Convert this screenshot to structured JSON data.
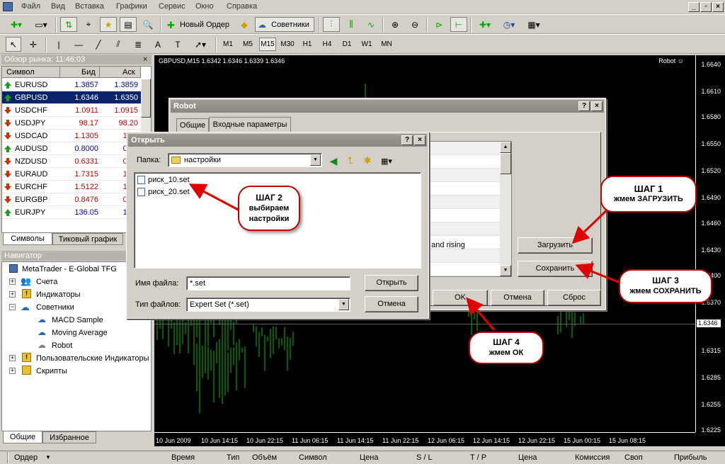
{
  "menu": [
    "Файл",
    "Вид",
    "Вставка",
    "Графики",
    "Сервис",
    "Окно",
    "Справка"
  ],
  "toolbar": {
    "new_order": "Новый Ордер",
    "experts": "Советники",
    "timeframes": [
      "M1",
      "M5",
      "M15",
      "M30",
      "H1",
      "H4",
      "D1",
      "W1",
      "MN"
    ],
    "active_timeframe": "M15"
  },
  "market_watch": {
    "title": "Обзор рынка: 11:46:03",
    "columns": [
      "Символ",
      "Бид",
      "Аск"
    ],
    "rows": [
      {
        "symbol": "EURUSD",
        "bid": "1.3857",
        "ask": "1.3859",
        "dir": "up"
      },
      {
        "symbol": "GBPUSD",
        "bid": "1.6346",
        "ask": "1.6350",
        "dir": "up"
      },
      {
        "symbol": "USDCHF",
        "bid": "1.0911",
        "ask": "1.0915",
        "dir": "down"
      },
      {
        "symbol": "USDJPY",
        "bid": "98.17",
        "ask": "98.20",
        "dir": "down"
      },
      {
        "symbol": "USDCAD",
        "bid": "1.1305",
        "ask": "1.13",
        "dir": "down"
      },
      {
        "symbol": "AUDUSD",
        "bid": "0.8000",
        "ask": "0.80",
        "dir": "up"
      },
      {
        "symbol": "NZDUSD",
        "bid": "0.6331",
        "ask": "0.63",
        "dir": "down"
      },
      {
        "symbol": "EURAUD",
        "bid": "1.7315",
        "ask": "1.73",
        "dir": "down"
      },
      {
        "symbol": "EURCHF",
        "bid": "1.5122",
        "ask": "1.51",
        "dir": "down"
      },
      {
        "symbol": "EURGBP",
        "bid": "0.8476",
        "ask": "0.84",
        "dir": "down"
      },
      {
        "symbol": "EURJPY",
        "bid": "136.05",
        "ask": "136.",
        "dir": "up"
      }
    ],
    "tabs": [
      "Символы",
      "Тиковый график"
    ]
  },
  "navigator": {
    "title": "Навигатор",
    "root": "MetaTrader - E-Global TFG",
    "items": [
      "Счета",
      "Индикаторы",
      "Советники",
      "MACD Sample",
      "Moving Average",
      "Robot",
      "Пользовательские Индикаторы",
      "Скрипты"
    ],
    "tabs": [
      "Общие",
      "Избранное"
    ]
  },
  "chart": {
    "header": "GBPUSD,M15  1.6342 1.6346 1.6339 1.6346",
    "expert": "Robot",
    "prices": [
      "1.6640",
      "1.6610",
      "1.6580",
      "1.6550",
      "1.6520",
      "1.6490",
      "1.6460",
      "1.6430",
      "1.6400",
      "1.6370",
      "1.6346",
      "1.6315",
      "1.6285",
      "1.6255",
      "1.6225"
    ],
    "dates": [
      "10 Jun 2009",
      "10 Jun 14:15",
      "10 Jun 22:15",
      "11 Jun 06:15",
      "11 Jun 14:15",
      "11 Jun 22:15",
      "12 Jun 06:15",
      "12 Jun 14:15",
      "12 Jun 22:15",
      "15 Jun 00:15",
      "15 Jun 08:15"
    ]
  },
  "robot_dialog": {
    "title": "Robot",
    "tabs": [
      "Общие",
      "Входные параметры"
    ],
    "visible_text": "e and rising",
    "load": "Загрузить",
    "save": "Сохранить",
    "ok": "OK",
    "cancel": "Отмена",
    "reset": "Сброс"
  },
  "open_dialog": {
    "title": "Открыть",
    "folder_label": "Папка:",
    "folder": "настройки",
    "files": [
      "риск_10.set",
      "риск_20.set"
    ],
    "filename_label": "Имя файла:",
    "filename": "*.set",
    "filetype_label": "Тип файлов:",
    "filetype": "Expert Set (*.set)",
    "open": "Открыть",
    "cancel": "Отмена"
  },
  "callouts": {
    "step1_title": "ШАГ 1",
    "step1_text": "жмем ЗАГРУЗИТЬ",
    "step2_title": "ШАГ 2",
    "step2_line1": "выбираем",
    "step2_line2": "настройки",
    "step3_title": "ШАГ 3",
    "step3_text": "жмем СОХРАНИТЬ",
    "step4_title": "ШАГ 4",
    "step4_text": "жмем ОК"
  },
  "status": [
    "Ордер",
    "Время",
    "Тип",
    "Объём",
    "Символ",
    "Цена",
    "S / L",
    "T / P",
    "Цена",
    "Комиссия",
    "Своп",
    "Прибыль"
  ],
  "colors": {
    "callout_border": "#c00000",
    "chart_bg": "#000000",
    "candles": "#00c000"
  }
}
